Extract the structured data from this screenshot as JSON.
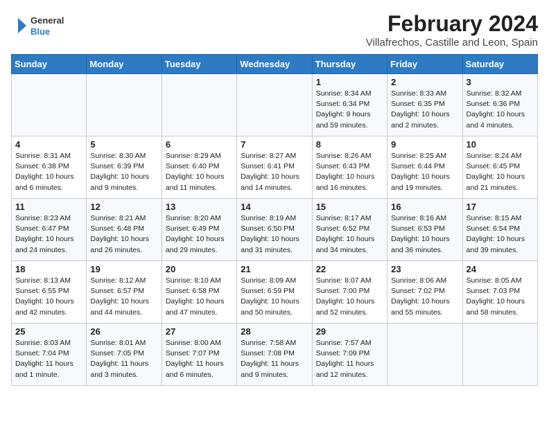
{
  "header": {
    "logo_general": "General",
    "logo_blue": "Blue",
    "month_year": "February 2024",
    "location": "Villafrechos, Castille and Leon, Spain"
  },
  "weekdays": [
    "Sunday",
    "Monday",
    "Tuesday",
    "Wednesday",
    "Thursday",
    "Friday",
    "Saturday"
  ],
  "weeks": [
    [
      {
        "day": "",
        "info": ""
      },
      {
        "day": "",
        "info": ""
      },
      {
        "day": "",
        "info": ""
      },
      {
        "day": "",
        "info": ""
      },
      {
        "day": "1",
        "info": "Sunrise: 8:34 AM\nSunset: 6:34 PM\nDaylight: 9 hours\nand 59 minutes."
      },
      {
        "day": "2",
        "info": "Sunrise: 8:33 AM\nSunset: 6:35 PM\nDaylight: 10 hours\nand 2 minutes."
      },
      {
        "day": "3",
        "info": "Sunrise: 8:32 AM\nSunset: 6:36 PM\nDaylight: 10 hours\nand 4 minutes."
      }
    ],
    [
      {
        "day": "4",
        "info": "Sunrise: 8:31 AM\nSunset: 6:38 PM\nDaylight: 10 hours\nand 6 minutes."
      },
      {
        "day": "5",
        "info": "Sunrise: 8:30 AM\nSunset: 6:39 PM\nDaylight: 10 hours\nand 9 minutes."
      },
      {
        "day": "6",
        "info": "Sunrise: 8:29 AM\nSunset: 6:40 PM\nDaylight: 10 hours\nand 11 minutes."
      },
      {
        "day": "7",
        "info": "Sunrise: 8:27 AM\nSunset: 6:41 PM\nDaylight: 10 hours\nand 14 minutes."
      },
      {
        "day": "8",
        "info": "Sunrise: 8:26 AM\nSunset: 6:43 PM\nDaylight: 10 hours\nand 16 minutes."
      },
      {
        "day": "9",
        "info": "Sunrise: 8:25 AM\nSunset: 6:44 PM\nDaylight: 10 hours\nand 19 minutes."
      },
      {
        "day": "10",
        "info": "Sunrise: 8:24 AM\nSunset: 6:45 PM\nDaylight: 10 hours\nand 21 minutes."
      }
    ],
    [
      {
        "day": "11",
        "info": "Sunrise: 8:23 AM\nSunset: 6:47 PM\nDaylight: 10 hours\nand 24 minutes."
      },
      {
        "day": "12",
        "info": "Sunrise: 8:21 AM\nSunset: 6:48 PM\nDaylight: 10 hours\nand 26 minutes."
      },
      {
        "day": "13",
        "info": "Sunrise: 8:20 AM\nSunset: 6:49 PM\nDaylight: 10 hours\nand 29 minutes."
      },
      {
        "day": "14",
        "info": "Sunrise: 8:19 AM\nSunset: 6:50 PM\nDaylight: 10 hours\nand 31 minutes."
      },
      {
        "day": "15",
        "info": "Sunrise: 8:17 AM\nSunset: 6:52 PM\nDaylight: 10 hours\nand 34 minutes."
      },
      {
        "day": "16",
        "info": "Sunrise: 8:16 AM\nSunset: 6:53 PM\nDaylight: 10 hours\nand 36 minutes."
      },
      {
        "day": "17",
        "info": "Sunrise: 8:15 AM\nSunset: 6:54 PM\nDaylight: 10 hours\nand 39 minutes."
      }
    ],
    [
      {
        "day": "18",
        "info": "Sunrise: 8:13 AM\nSunset: 6:55 PM\nDaylight: 10 hours\nand 42 minutes."
      },
      {
        "day": "19",
        "info": "Sunrise: 8:12 AM\nSunset: 6:57 PM\nDaylight: 10 hours\nand 44 minutes."
      },
      {
        "day": "20",
        "info": "Sunrise: 8:10 AM\nSunset: 6:58 PM\nDaylight: 10 hours\nand 47 minutes."
      },
      {
        "day": "21",
        "info": "Sunrise: 8:09 AM\nSunset: 6:59 PM\nDaylight: 10 hours\nand 50 minutes."
      },
      {
        "day": "22",
        "info": "Sunrise: 8:07 AM\nSunset: 7:00 PM\nDaylight: 10 hours\nand 52 minutes."
      },
      {
        "day": "23",
        "info": "Sunrise: 8:06 AM\nSunset: 7:02 PM\nDaylight: 10 hours\nand 55 minutes."
      },
      {
        "day": "24",
        "info": "Sunrise: 8:05 AM\nSunset: 7:03 PM\nDaylight: 10 hours\nand 58 minutes."
      }
    ],
    [
      {
        "day": "25",
        "info": "Sunrise: 8:03 AM\nSunset: 7:04 PM\nDaylight: 11 hours\nand 1 minute."
      },
      {
        "day": "26",
        "info": "Sunrise: 8:01 AM\nSunset: 7:05 PM\nDaylight: 11 hours\nand 3 minutes."
      },
      {
        "day": "27",
        "info": "Sunrise: 8:00 AM\nSunset: 7:07 PM\nDaylight: 11 hours\nand 6 minutes."
      },
      {
        "day": "28",
        "info": "Sunrise: 7:58 AM\nSunset: 7:08 PM\nDaylight: 11 hours\nand 9 minutes."
      },
      {
        "day": "29",
        "info": "Sunrise: 7:57 AM\nSunset: 7:09 PM\nDaylight: 11 hours\nand 12 minutes."
      },
      {
        "day": "",
        "info": ""
      },
      {
        "day": "",
        "info": ""
      }
    ]
  ]
}
